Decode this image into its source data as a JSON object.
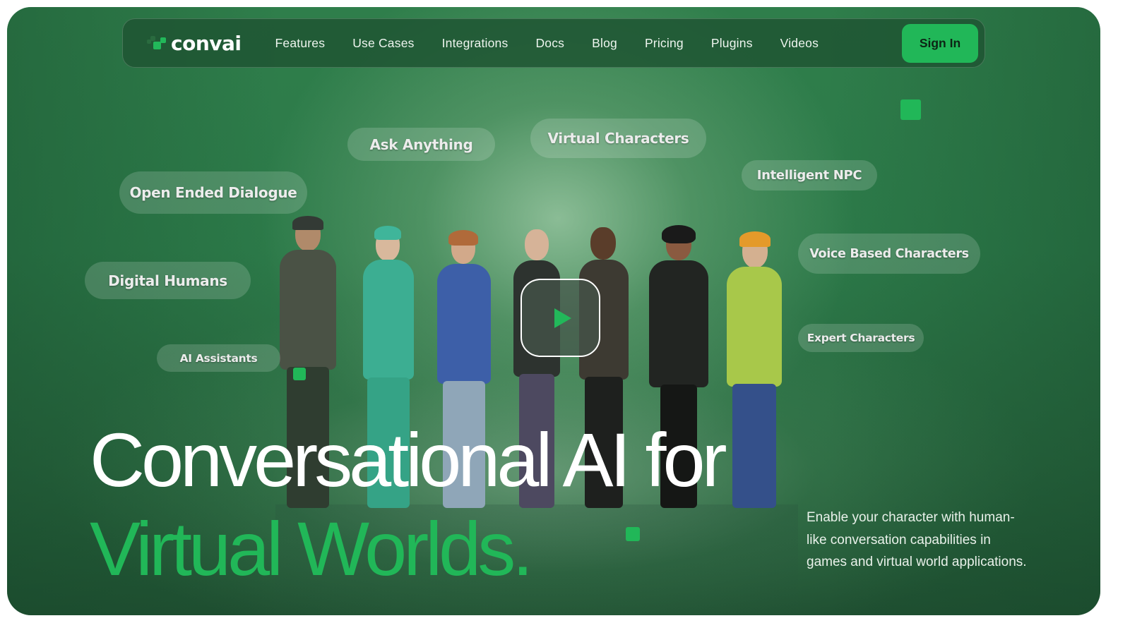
{
  "nav": {
    "logo_text": "convai",
    "links": [
      "Features",
      "Use Cases",
      "Integrations",
      "Docs",
      "Blog",
      "Pricing",
      "Plugins",
      "Videos"
    ],
    "sign_in_label": "Sign In"
  },
  "tags": {
    "ask_anything": "Ask Anything",
    "virtual_characters": "Virtual Characters",
    "open_ended_dialogue": "Open Ended Dialogue",
    "intelligent_npc": "Intelligent NPC",
    "digital_humans": "Digital Humans",
    "voice_based_characters": "Voice Based Characters",
    "ai_assistants": "AI Assistants",
    "expert_characters": "Expert Characters"
  },
  "hero": {
    "headline_line1": "Conversational AI for",
    "headline_line2": "Virtual Worlds.",
    "description": "Enable your character with human-like conversation capabilities in games and virtual world applications.",
    "play_icon": "play-icon"
  },
  "colors": {
    "accent": "#21b758",
    "background": "#2c7a49",
    "text": "#ffffff"
  }
}
